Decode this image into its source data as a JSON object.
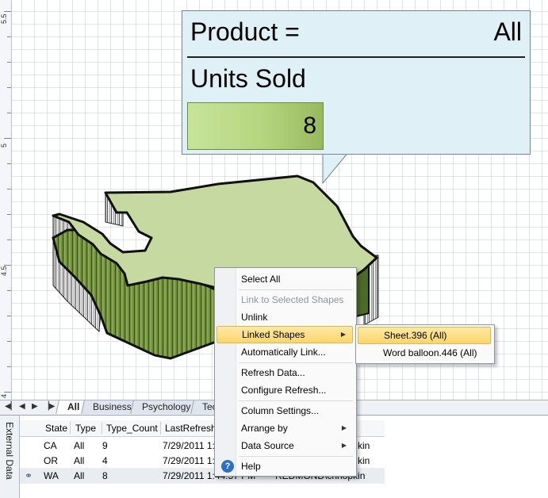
{
  "ruler": {
    "labels": [
      "5.5",
      "5",
      "4.5",
      "4"
    ]
  },
  "balloon": {
    "product_label": "Product =",
    "product_value": "All",
    "units_label": "Units Sold",
    "units_value": "8"
  },
  "sheet_tabs": {
    "tabs": [
      "All",
      "Business",
      "Psychology",
      "Tec"
    ],
    "active": "All",
    "nav_icons": [
      "first-page-icon",
      "previous-page-icon",
      "next-page-icon",
      "last-page-icon"
    ]
  },
  "external_data": {
    "panel_title": "External Data",
    "columns": [
      "State",
      "Type",
      "Type_Count",
      "LastRefresh"
    ],
    "rows": [
      {
        "state": "CA",
        "type": "All",
        "count": "9",
        "refresh": "7/29/2011 1:",
        "extra": "kin"
      },
      {
        "state": "OR",
        "type": "All",
        "count": "4",
        "refresh": "7/29/2011 1:",
        "extra": "kin"
      },
      {
        "state": "WA",
        "type": "All",
        "count": "8",
        "refresh": "7/29/2011 1:44:57 PM",
        "extra": "REDMOND\\chhopkin"
      }
    ]
  },
  "context_menu": {
    "items": [
      {
        "label": "Select All",
        "disabled": false
      },
      {
        "label": "Link to Selected Shapes",
        "disabled": true
      },
      {
        "label": "Unlink",
        "disabled": false
      },
      {
        "label": "Linked Shapes",
        "disabled": false
      },
      {
        "label": "Automatically Link...",
        "disabled": false
      },
      {
        "label": "Refresh Data...",
        "disabled": false
      },
      {
        "label": "Configure Refresh...",
        "disabled": false
      },
      {
        "label": "Column Settings...",
        "disabled": false
      },
      {
        "label": "Arrange by",
        "disabled": false
      },
      {
        "label": "Data Source",
        "disabled": false
      },
      {
        "label": "Help",
        "disabled": false
      }
    ]
  },
  "submenu": {
    "items": [
      "Sheet.396 (All)",
      "Word balloon.446 (All)"
    ]
  },
  "colors": {
    "map_top": "#c5d9a0",
    "map_side_dark": "#3d5220",
    "map_side_mid": "#6f8f3a",
    "balloon_bg": "#dff0f6",
    "menu_highlight": "#fbd66b"
  }
}
